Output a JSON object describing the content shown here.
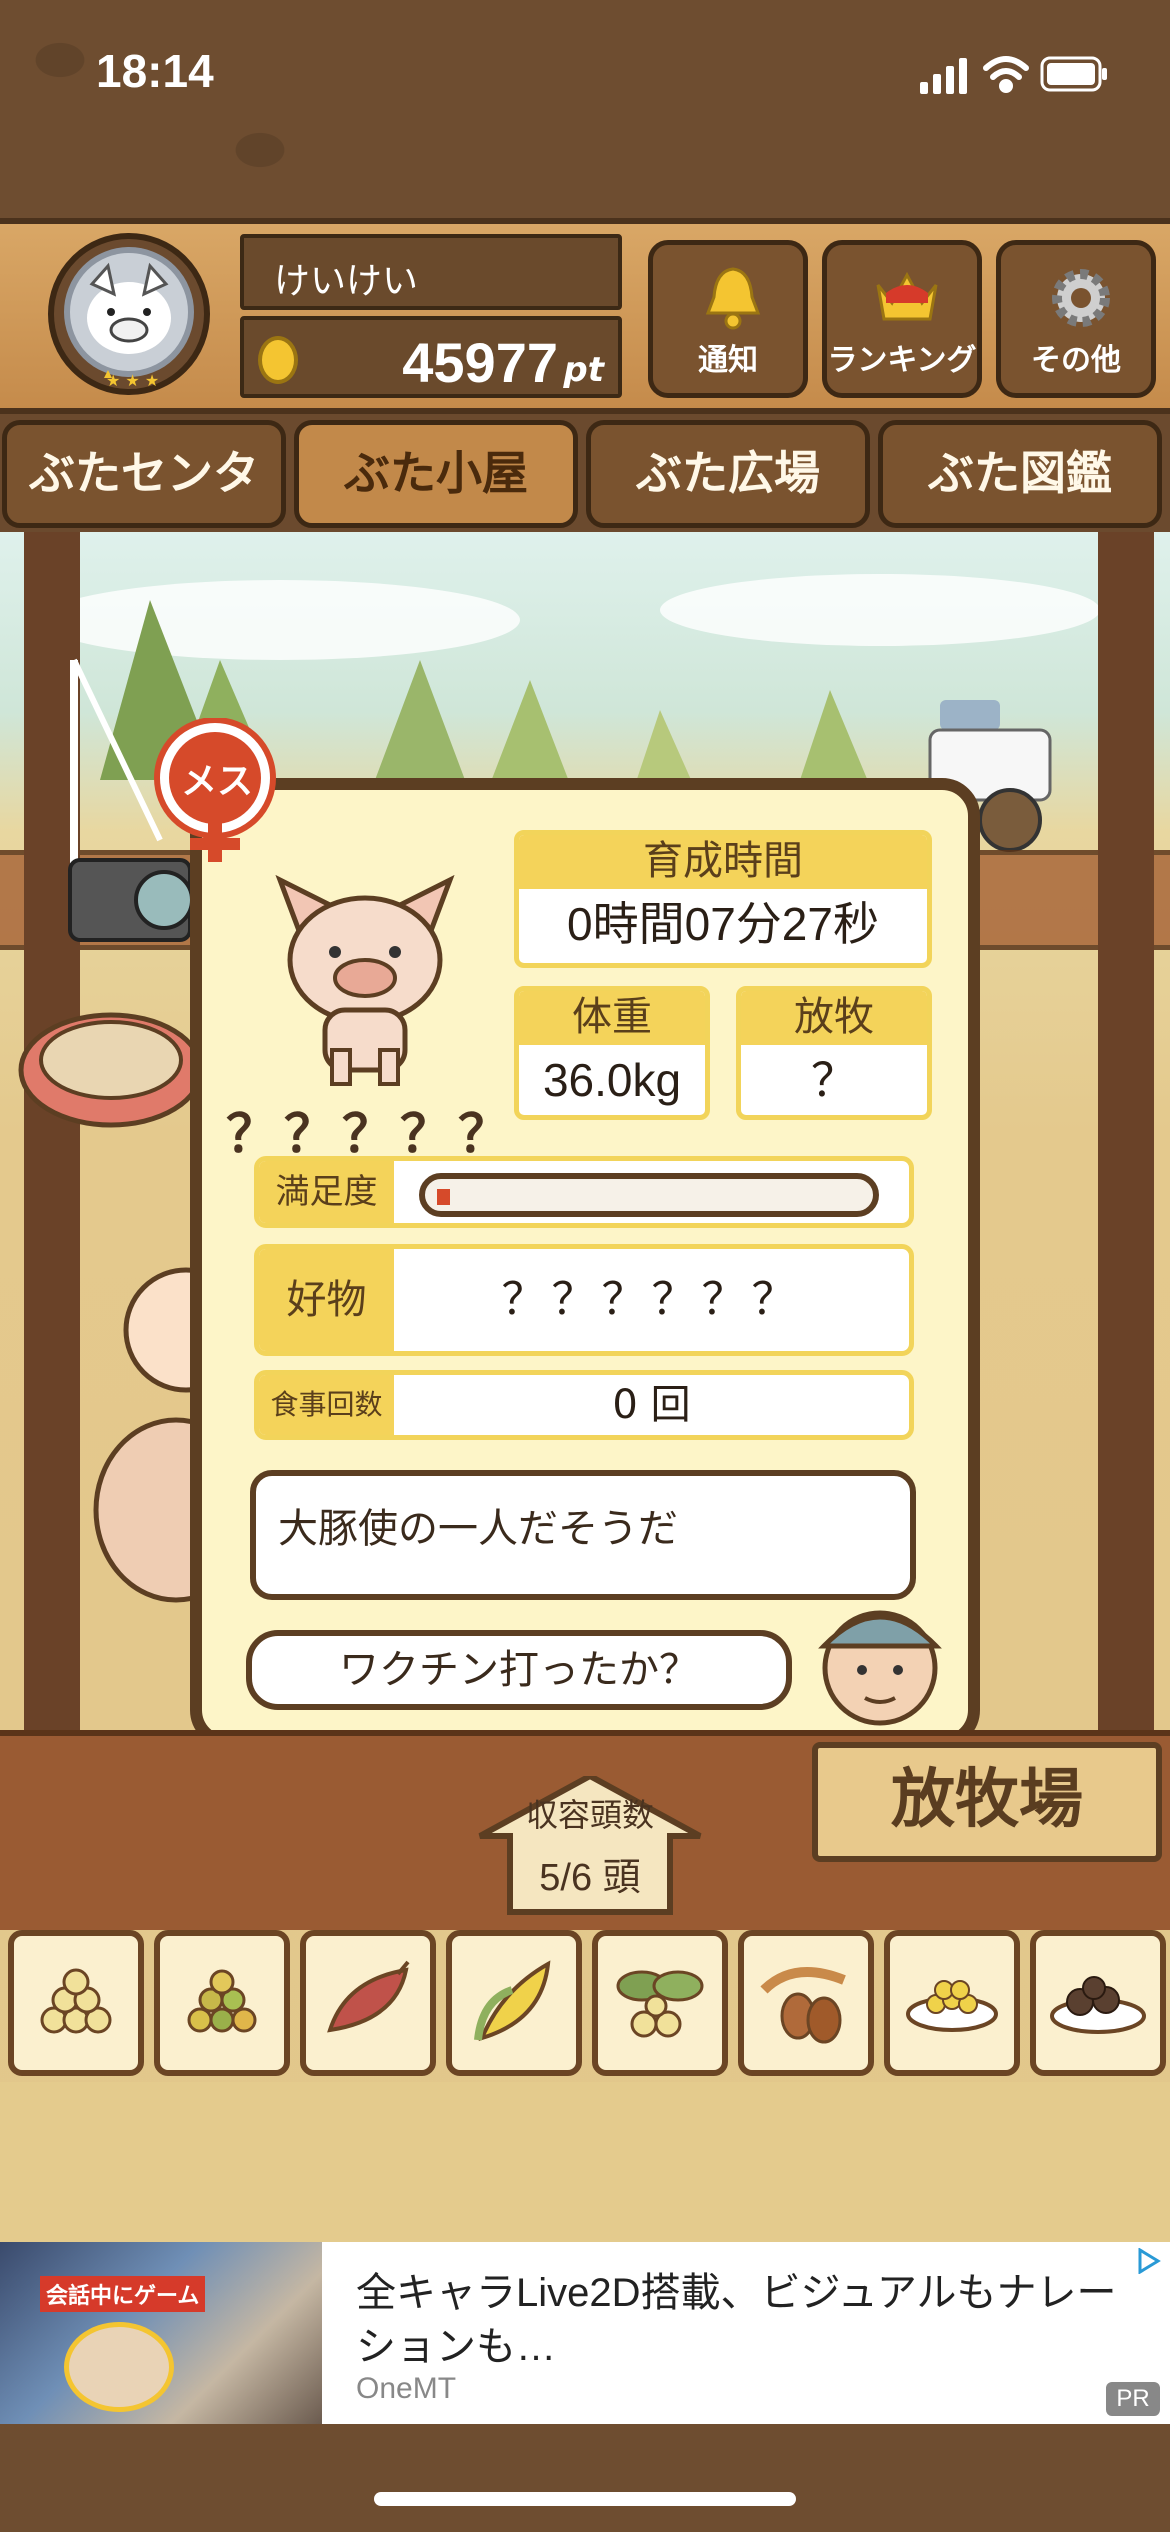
{
  "status_bar": {
    "time": "18:14"
  },
  "header": {
    "username": "けいけい",
    "points": "45977",
    "points_unit": "pt",
    "buttons": [
      {
        "label": "通知",
        "icon": "bell-icon"
      },
      {
        "label": "ランキング",
        "icon": "crown-icon"
      },
      {
        "label": "その他",
        "icon": "gear-icon"
      }
    ]
  },
  "tabs": [
    "ぶたセンター",
    "ぶた小屋",
    "ぶた広場",
    "ぶた図鑑"
  ],
  "active_tab": "ぶた小屋",
  "pig_card": {
    "gender_badge": "メス",
    "name": "？？？？？",
    "rearing_time": {
      "label": "育成時間",
      "value": "0時間07分27秒"
    },
    "weight": {
      "label": "体重",
      "value": "36.0kg"
    },
    "grazing": {
      "label": "放牧",
      "value": "？"
    },
    "satisfaction": {
      "label": "満足度",
      "level": 0.03
    },
    "favorite": {
      "label": "好物",
      "value": "？？？？？？"
    },
    "meal_count": {
      "label": "食事回数",
      "value": "0 回"
    },
    "description": "大豚使の一人だそうだ",
    "farmer_speech": "ワクチン打ったか？"
  },
  "capacity": {
    "label": "収容頭数",
    "value": "5/6 頭"
  },
  "pasture_sign": "放牧場",
  "food_items": [
    "soybeans-icon",
    "mixed-grain-icon",
    "sweet-potato-icon",
    "corn-icon",
    "nuts-leaves-icon",
    "acorn-icon",
    "grain-bowl-icon",
    "chestnut-plate-icon"
  ],
  "ad": {
    "thumb_caption": "会話中にゲーム",
    "text": "全キャラLive2D搭載、ビジュアルもナレーションも…",
    "brand": "OneMT",
    "badge": "PR"
  },
  "colors": {
    "wood_dark": "#5c3e22",
    "panel_yellow": "#f4d35a",
    "card_bg": "#fdf5c8",
    "accent_red": "#d64a2a"
  }
}
